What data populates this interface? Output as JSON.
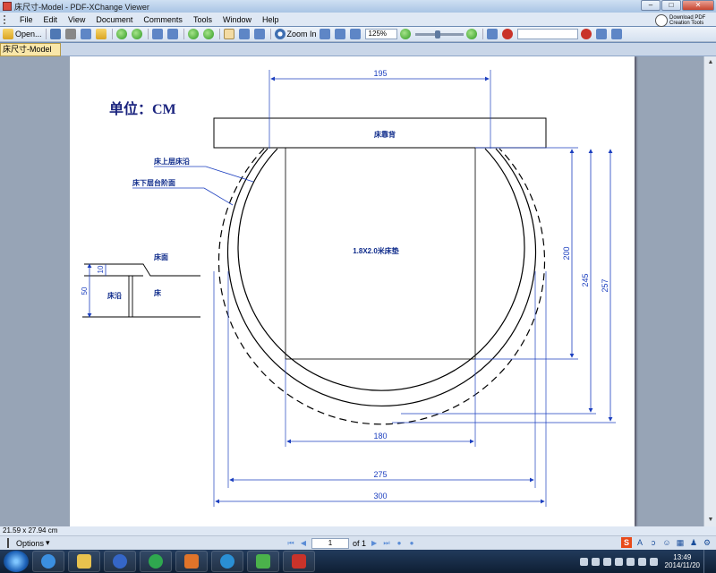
{
  "window": {
    "title": "床尺寸-Model - PDF-XChange Viewer",
    "buttons": [
      "–",
      "□",
      "✕"
    ]
  },
  "menu": [
    "File",
    "Edit",
    "View",
    "Document",
    "Comments",
    "Tools",
    "Window",
    "Help"
  ],
  "promo": {
    "line1": "Download PDF",
    "line2": "Creation Tools"
  },
  "toolbar": {
    "open_label": "Open...",
    "zoom_in_label": "Zoom In",
    "zoom_value": "125%"
  },
  "tab": {
    "label": "床尺寸-Model"
  },
  "drawing": {
    "unit_label": "单位：CM",
    "headboard_label": "床靠背",
    "mattress_label": "1.8X2.0米床垫",
    "upper_edge_label": "床上层床沿",
    "lower_step_label": "床下层台阶面",
    "dims": {
      "top_width": "195",
      "mattress_width": "180",
      "inner_width": "275",
      "outer_width": "300",
      "mattress_length": "200",
      "inner_length": "245",
      "outer_length": "257"
    },
    "section": {
      "surface_label": "床面",
      "edge_label": "床沿",
      "bed_label": "床",
      "dim_small": "10",
      "dim_large": "50"
    }
  },
  "status": {
    "page_size": "21.59 x 27.94 cm"
  },
  "nav": {
    "options_label": "Options",
    "page_value": "1",
    "of_label": "of 1"
  },
  "taskbar": {
    "time": "13:49",
    "date": "2014/11/20"
  }
}
